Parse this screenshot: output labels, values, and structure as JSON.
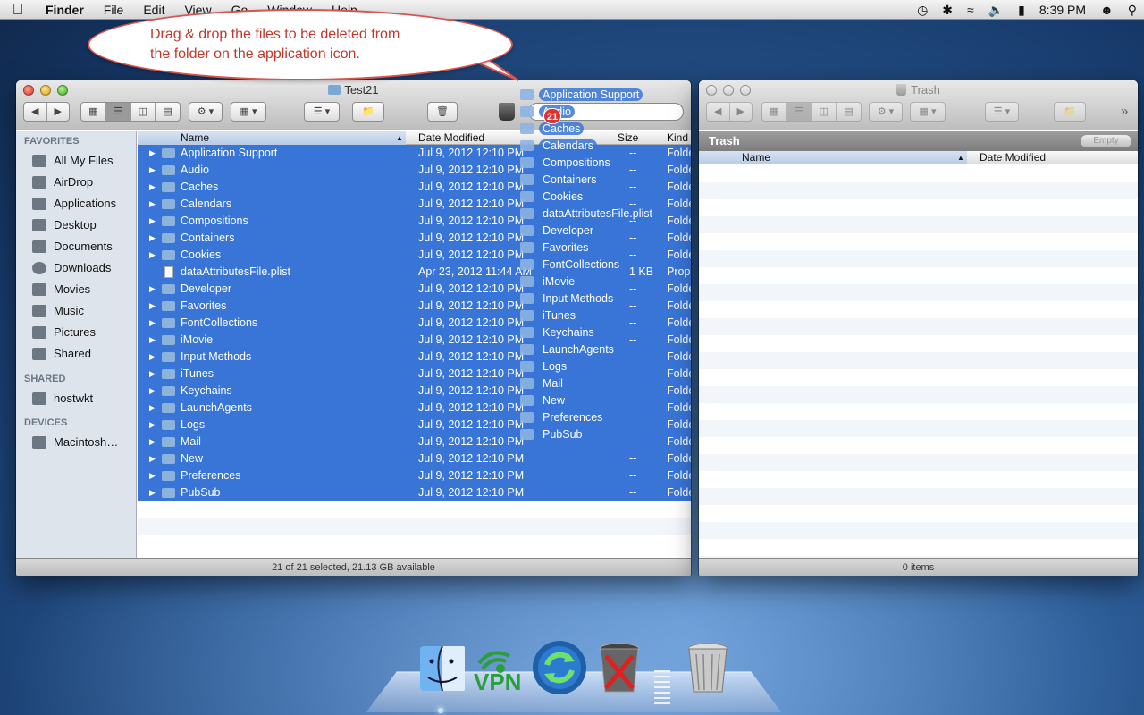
{
  "menubar": {
    "app": "Finder",
    "menus": [
      "File",
      "Edit",
      "View",
      "Go",
      "Window",
      "Help"
    ],
    "time": "8:39 PM"
  },
  "callout": {
    "line1": "Drag & drop the files to be deleted from",
    "line2": "the folder on the application icon."
  },
  "finder": {
    "title": "Test21",
    "sidebar": {
      "favorites_header": "FAVORITES",
      "favorites": [
        "All My Files",
        "AirDrop",
        "Applications",
        "Desktop",
        "Documents",
        "Downloads",
        "Movies",
        "Music",
        "Pictures",
        "Shared"
      ],
      "shared_header": "SHARED",
      "shared": [
        "hostwkt"
      ],
      "devices_header": "DEVICES",
      "devices": [
        "Macintosh…"
      ]
    },
    "columns": {
      "name": "Name",
      "date": "Date Modified",
      "size": "Size",
      "kind": "Kind"
    },
    "rows": [
      {
        "name": "Application Support",
        "date": "Jul 9, 2012 12:10 PM",
        "size": "--",
        "kind": "Folder",
        "folder": true
      },
      {
        "name": "Audio",
        "date": "Jul 9, 2012 12:10 PM",
        "size": "--",
        "kind": "Folder",
        "folder": true
      },
      {
        "name": "Caches",
        "date": "Jul 9, 2012 12:10 PM",
        "size": "--",
        "kind": "Folder",
        "folder": true
      },
      {
        "name": "Calendars",
        "date": "Jul 9, 2012 12:10 PM",
        "size": "--",
        "kind": "Folder",
        "folder": true
      },
      {
        "name": "Compositions",
        "date": "Jul 9, 2012 12:10 PM",
        "size": "--",
        "kind": "Folder",
        "folder": true
      },
      {
        "name": "Containers",
        "date": "Jul 9, 2012 12:10 PM",
        "size": "--",
        "kind": "Folder",
        "folder": true
      },
      {
        "name": "Cookies",
        "date": "Jul 9, 2012 12:10 PM",
        "size": "--",
        "kind": "Folder",
        "folder": true
      },
      {
        "name": "dataAttributesFile.plist",
        "date": "Apr 23, 2012 11:44 AM",
        "size": "1 KB",
        "kind": "Property",
        "folder": false
      },
      {
        "name": "Developer",
        "date": "Jul 9, 2012 12:10 PM",
        "size": "--",
        "kind": "Folder",
        "folder": true
      },
      {
        "name": "Favorites",
        "date": "Jul 9, 2012 12:10 PM",
        "size": "--",
        "kind": "Folder",
        "folder": true
      },
      {
        "name": "FontCollections",
        "date": "Jul 9, 2012 12:10 PM",
        "size": "--",
        "kind": "Folder",
        "folder": true
      },
      {
        "name": "iMovie",
        "date": "Jul 9, 2012 12:10 PM",
        "size": "--",
        "kind": "Folder",
        "folder": true
      },
      {
        "name": "Input Methods",
        "date": "Jul 9, 2012 12:10 PM",
        "size": "--",
        "kind": "Folder",
        "folder": true
      },
      {
        "name": "iTunes",
        "date": "Jul 9, 2012 12:10 PM",
        "size": "--",
        "kind": "Folder",
        "folder": true
      },
      {
        "name": "Keychains",
        "date": "Jul 9, 2012 12:10 PM",
        "size": "--",
        "kind": "Folder",
        "folder": true
      },
      {
        "name": "LaunchAgents",
        "date": "Jul 9, 2012 12:10 PM",
        "size": "--",
        "kind": "Folder",
        "folder": true
      },
      {
        "name": "Logs",
        "date": "Jul 9, 2012 12:10 PM",
        "size": "--",
        "kind": "Folder",
        "folder": true
      },
      {
        "name": "Mail",
        "date": "Jul 9, 2012 12:10 PM",
        "size": "--",
        "kind": "Folder",
        "folder": true
      },
      {
        "name": "New",
        "date": "Jul 9, 2012 12:10 PM",
        "size": "--",
        "kind": "Folder",
        "folder": true
      },
      {
        "name": "Preferences",
        "date": "Jul 9, 2012 12:10 PM",
        "size": "--",
        "kind": "Folder",
        "folder": true
      },
      {
        "name": "PubSub",
        "date": "Jul 9, 2012 12:10 PM",
        "size": "--",
        "kind": "Folder",
        "folder": true
      }
    ],
    "status": "21 of 21 selected, 21.13 GB available"
  },
  "drag": {
    "count": "21",
    "items": [
      "Application Support",
      "Audio",
      "Caches",
      "Calendars",
      "Compositions",
      "Containers",
      "Cookies",
      "dataAttributesFile.plist",
      "Developer",
      "Favorites",
      "FontCollections",
      "iMovie",
      "Input Methods",
      "iTunes",
      "Keychains",
      "LaunchAgents",
      "Logs",
      "Mail",
      "New",
      "Preferences",
      "PubSub"
    ]
  },
  "trash": {
    "title": "Trash",
    "bar_label": "Trash",
    "empty_label": "Empty",
    "columns": {
      "name": "Name",
      "date": "Date Modified"
    },
    "status": "0 items"
  },
  "dock": {
    "vpn_label": "VPN"
  }
}
